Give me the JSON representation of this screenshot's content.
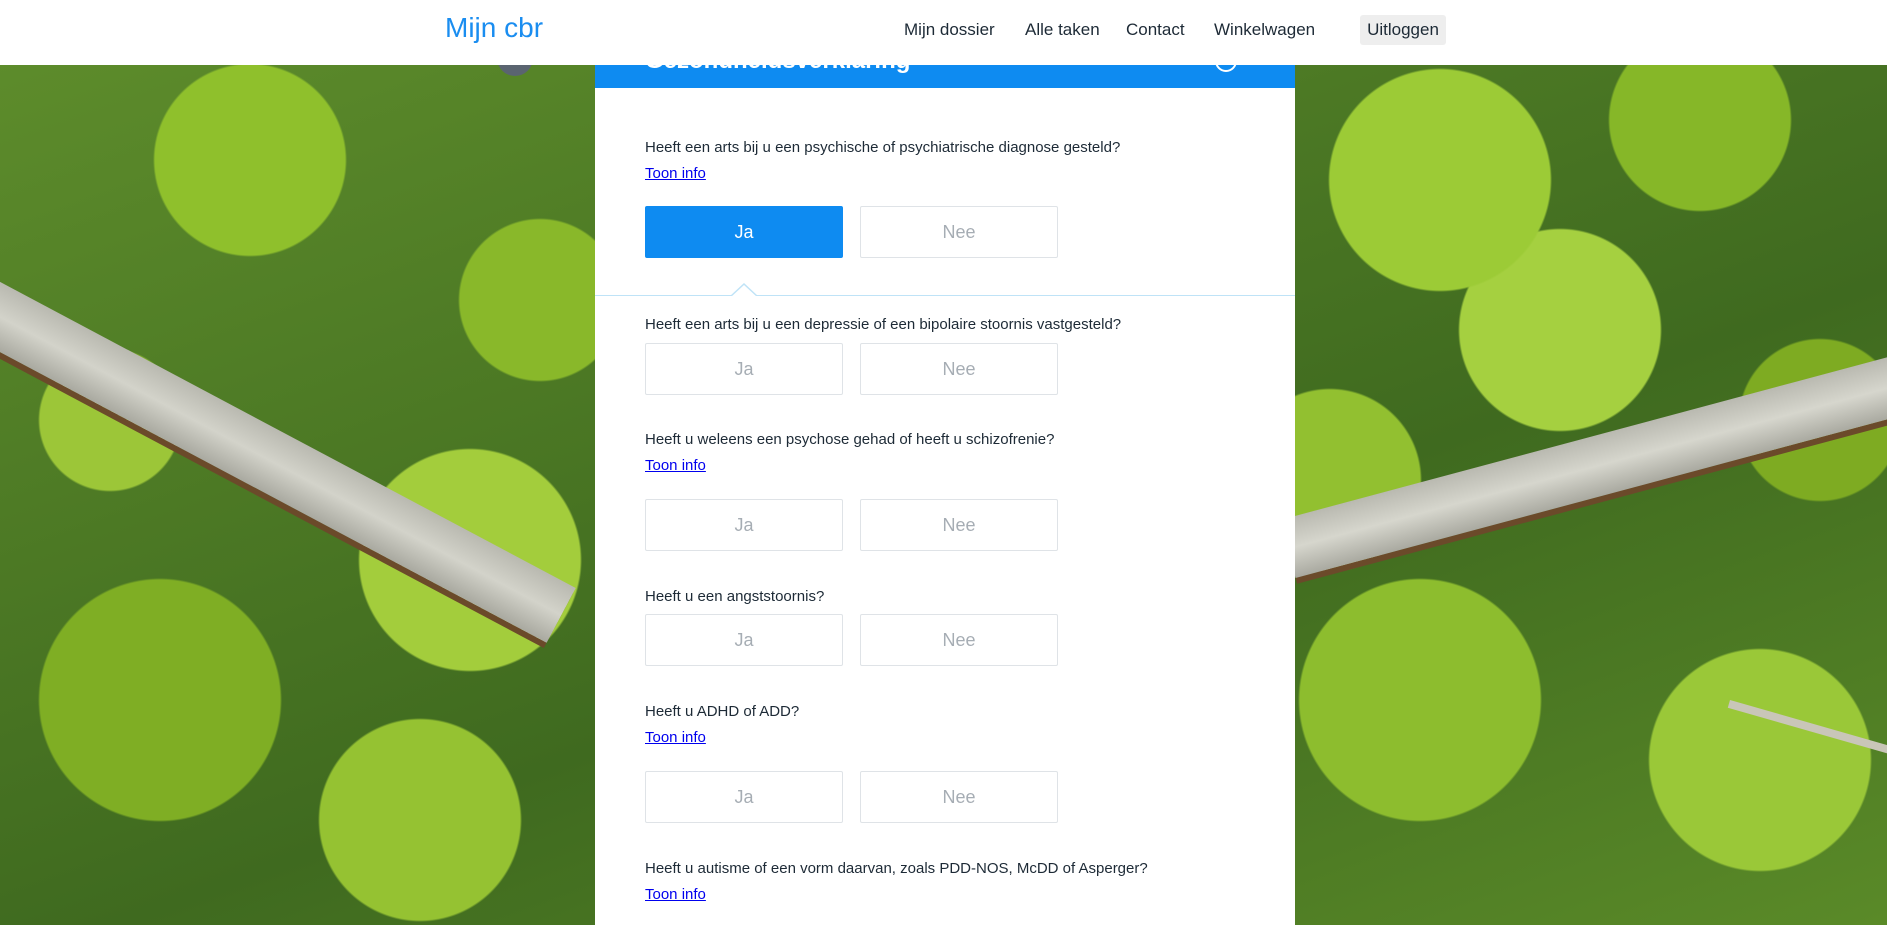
{
  "header": {
    "brand": "Mijn cbr",
    "nav": [
      "Mijn dossier",
      "Alle taken",
      "Contact",
      "Winkelwagen"
    ],
    "logout": "Uitloggen"
  },
  "card": {
    "title": "Gezondheidsverklaring",
    "info_icon": "i"
  },
  "questions": [
    {
      "text": "Heeft een arts bij u een psychische of psychiatrische diagnose gesteld?",
      "info": "Toon info",
      "yes": "Ja",
      "no": "Nee",
      "selected": "Ja"
    },
    {
      "text": "Heeft een arts bij u een depressie of een bipolaire stoornis vastgesteld?",
      "yes": "Ja",
      "no": "Nee"
    },
    {
      "text": "Heeft u weleens een psychose gehad of heeft u schizofrenie?",
      "info": "Toon info",
      "yes": "Ja",
      "no": "Nee"
    },
    {
      "text": "Heeft u een angststoornis?",
      "yes": "Ja",
      "no": "Nee"
    },
    {
      "text": "Heeft u ADHD of ADD?",
      "info": "Toon info",
      "yes": "Ja",
      "no": "Nee"
    },
    {
      "text": "Heeft u autisme of een vorm daarvan, zoals PDD-NOS, McDD of Asperger?",
      "info": "Toon info"
    }
  ],
  "colors": {
    "accent": "#0e8bf1",
    "brand": "#1a8df0"
  }
}
